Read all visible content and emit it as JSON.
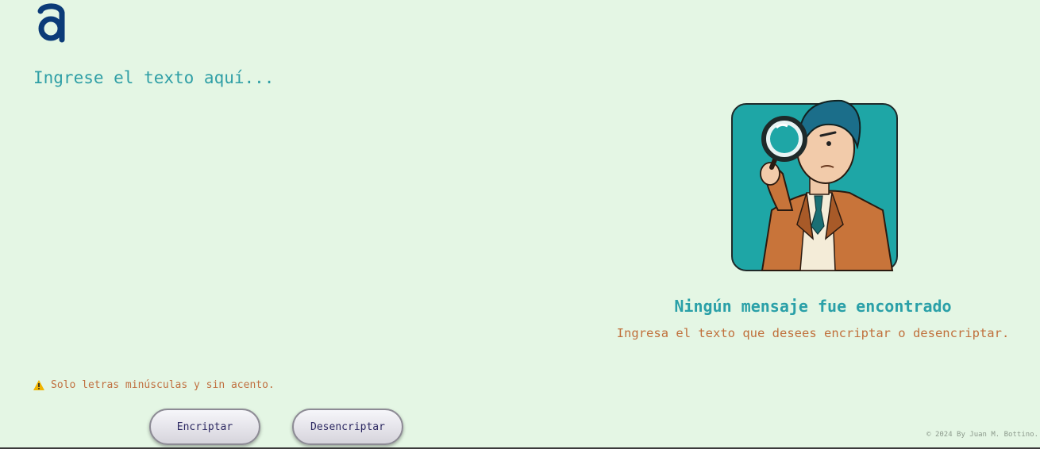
{
  "logo": {
    "icon": "alura-logo",
    "color": "#0b3b78"
  },
  "input": {
    "placeholder": "Ingrese el texto aquí...",
    "value": ""
  },
  "warning": {
    "icon": "warning-icon",
    "text": "Solo letras minúsculas y sin acento."
  },
  "buttons": {
    "encrypt_label": "Encriptar",
    "decrypt_label": "Desencriptar"
  },
  "output": {
    "illustration": "detective-with-magnifying-glass",
    "title": "Ningún mensaje fue encontrado",
    "subtitle": "Ingresa el texto que desees encriptar o desencriptar."
  },
  "footer": {
    "text": "© 2024 By Juan M. Bottino."
  },
  "colors": {
    "background": "#e4f6e4",
    "accent": "#2aa0a8",
    "secondary": "#c0703c"
  }
}
